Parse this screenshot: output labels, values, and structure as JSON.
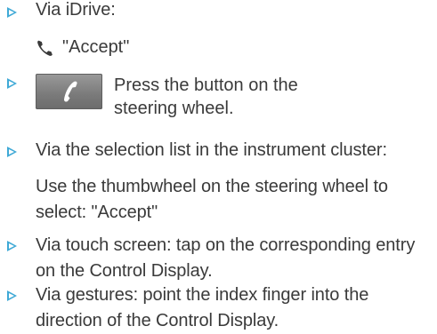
{
  "items": [
    {
      "label": "Via iDrive:",
      "sub": "\"Accept\"",
      "sub_icon": "phone-handset-icon"
    },
    {
      "icon": "phone-button-icon",
      "label": "Press the button on the steering wheel."
    },
    {
      "label": "Via the selection list in the instrument cluster:",
      "sub": "Use the thumbwheel on the steering wheel to select: \"Accept\""
    },
    {
      "label": "Via touch screen: tap on the corresponding entry on the Control Display."
    },
    {
      "label": "Via gestures: point the index finger into the direction of the Control Display."
    }
  ],
  "colors": {
    "bullet": "#3fa9d6",
    "text": "#3a3a3a",
    "button_bg": "#7a7a7a"
  }
}
